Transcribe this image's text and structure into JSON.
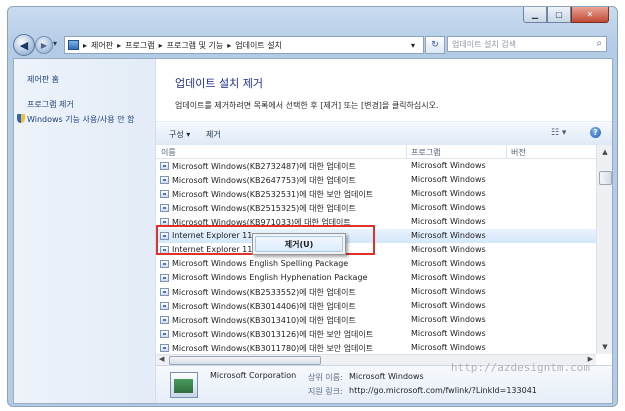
{
  "window": {
    "min": "▁",
    "max": "▢",
    "close": "✕"
  },
  "nav": {
    "back": "◀",
    "forward": "▶",
    "dropdown": "▾",
    "breadcrumb": [
      "제어판",
      "프로그램",
      "프로그램 및 기능",
      "업데이트 설치"
    ],
    "refresh": "↻",
    "search_placeholder": "업데이트 설치 검색",
    "search_icon": "search-icon"
  },
  "sidebar": {
    "items": [
      "제어판 홈",
      "프로그램 제거",
      "Windows 기능 사용/사용 안 함"
    ]
  },
  "main": {
    "title": "업데이트 설치 제거",
    "description": "업데이트를 제거하려면 목록에서 선택한 후 [제거] 또는 [변경]을 클릭하십시오."
  },
  "toolbar": {
    "organize": "구성 ▾",
    "uninstall": "제거",
    "views_icon": "views-icon",
    "help": "?"
  },
  "columns": [
    "이름",
    "프로그램",
    "버전"
  ],
  "rows": [
    {
      "name": "Microsoft Windows(KB2732487)에 대한 업데이트",
      "program": "Microsoft Windows"
    },
    {
      "name": "Microsoft Windows(KB2647753)에 대한 업데이트",
      "program": "Microsoft Windows"
    },
    {
      "name": "Microsoft Windows(KB2532531)에 대한 보안 업데이트",
      "program": "Microsoft Windows"
    },
    {
      "name": "Microsoft Windows(KB2515325)에 대한 업데이트",
      "program": "Microsoft Windows"
    },
    {
      "name": "Microsoft Windows(KB971033)에 대한 업데이트",
      "program": "Microsoft Windows"
    },
    {
      "name": "Internet Explorer 11",
      "program": "Microsoft Windows"
    },
    {
      "name": "Internet Explorer 11",
      "program": "Microsoft Windows"
    },
    {
      "name": "Microsoft Windows English Spelling Package",
      "program": "Microsoft Windows"
    },
    {
      "name": "Microsoft Windows English Hyphenation Package",
      "program": "Microsoft Windows"
    },
    {
      "name": "Microsoft Windows(KB2533552)에 대한 업데이트",
      "program": "Microsoft Windows"
    },
    {
      "name": "Microsoft Windows(KB3014406)에 대한 업데이트",
      "program": "Microsoft Windows"
    },
    {
      "name": "Microsoft Windows(KB3013410)에 대한 업데이트",
      "program": "Microsoft Windows"
    },
    {
      "name": "Microsoft Windows(KB3013126)에 대한 보안 업데이트",
      "program": "Microsoft Windows"
    },
    {
      "name": "Microsoft Windows(KB3011780)에 대한 보안 업데이트",
      "program": "Microsoft Windows"
    }
  ],
  "context_menu": {
    "uninstall": "제거(U)"
  },
  "details": {
    "publisher": "Microsoft Corporation",
    "parent_label": "상위 이름:",
    "parent_value": "Microsoft Windows",
    "support_label": "지원 링크:",
    "support_value": "http://go.microsoft.com/fwlink/?LinkId=133041"
  },
  "watermark": "http://azdesigntm.com"
}
